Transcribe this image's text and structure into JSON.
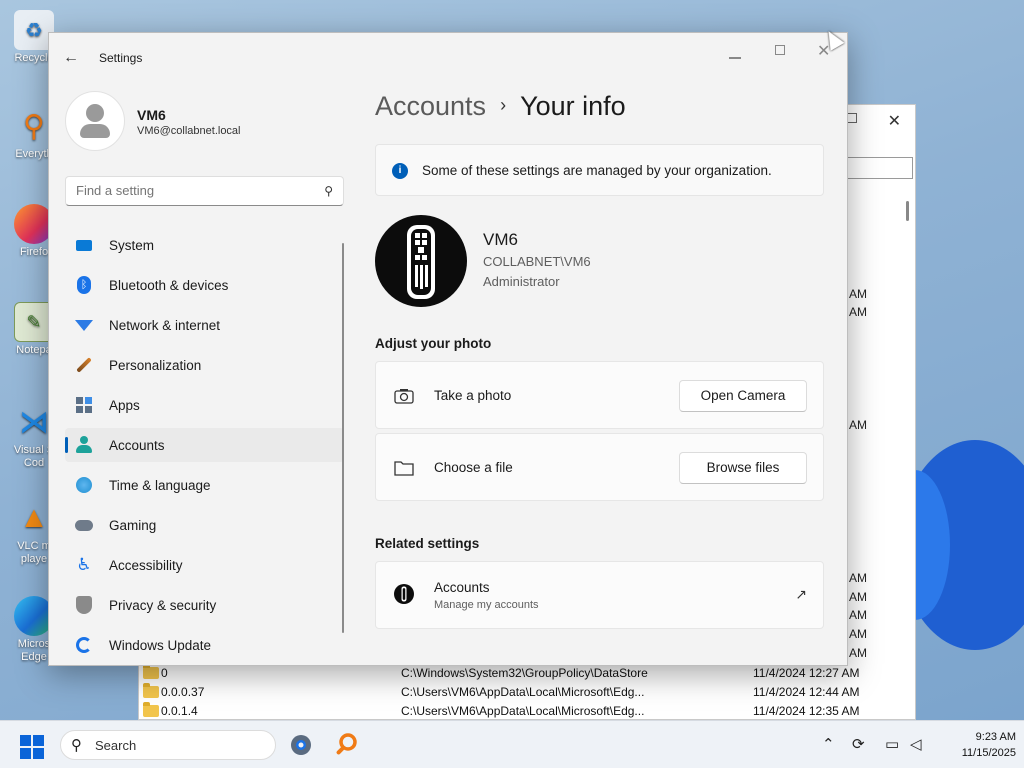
{
  "desktop": {
    "icons": [
      {
        "label": "Recycle",
        "icon": "recycle-bin-icon"
      },
      {
        "label": "Everyth",
        "icon": "everything-search-icon"
      },
      {
        "label": "Firefo",
        "icon": "firefox-icon"
      },
      {
        "label": "Notepa",
        "icon": "notepad-icon"
      },
      {
        "label": "Visual S Cod",
        "icon": "vscode-icon"
      },
      {
        "label": "VLC m playe",
        "icon": "vlc-icon"
      },
      {
        "label": "Micros Edge",
        "icon": "edge-icon"
      }
    ]
  },
  "explorer": {
    "time_fragments": [
      "AM",
      "AM",
      "AM",
      "AM",
      "AM",
      "AM",
      "AM",
      "AM",
      "AM",
      "AM",
      "AM"
    ],
    "rows": [
      {
        "name": "0",
        "path": "C:\\Windows\\System32\\GroupPolicy\\DataStore",
        "modified": "11/4/2024 12:27 AM"
      },
      {
        "name": "0.0.0.37",
        "path": "C:\\Users\\VM6\\AppData\\Local\\Microsoft\\Edg...",
        "modified": "11/4/2024 12:44 AM"
      },
      {
        "name": "0.0.1.4",
        "path": "C:\\Users\\VM6\\AppData\\Local\\Microsoft\\Edg...",
        "modified": "11/4/2024 12:35 AM"
      }
    ]
  },
  "settings": {
    "window_title": "Settings",
    "user": {
      "name": "VM6",
      "email": "VM6@collabnet.local"
    },
    "search_placeholder": "Find a setting",
    "nav": [
      {
        "label": "System",
        "icon": "monitor-icon",
        "color": "#0a7ad6"
      },
      {
        "label": "Bluetooth & devices",
        "icon": "bluetooth-icon",
        "color": "#1a73e8"
      },
      {
        "label": "Network & internet",
        "icon": "wifi-icon",
        "color": "#2c7be5"
      },
      {
        "label": "Personalization",
        "icon": "brush-icon",
        "color": "#d9822b"
      },
      {
        "label": "Apps",
        "icon": "apps-icon",
        "color": "#5b6f86"
      },
      {
        "label": "Accounts",
        "icon": "person-icon",
        "color": "#1da29a",
        "active": true
      },
      {
        "label": "Time & language",
        "icon": "globe-clock-icon",
        "color": "#1f8fd1"
      },
      {
        "label": "Gaming",
        "icon": "gamepad-icon",
        "color": "#6f7b8a"
      },
      {
        "label": "Accessibility",
        "icon": "accessibility-icon",
        "color": "#1a73e8"
      },
      {
        "label": "Privacy & security",
        "icon": "shield-icon",
        "color": "#8a8a8a"
      },
      {
        "label": "Windows Update",
        "icon": "update-icon",
        "color": "#1a73e8"
      }
    ],
    "breadcrumb": {
      "parent": "Accounts",
      "separator": "›",
      "current": "Your info"
    },
    "banner_text": "Some of these settings are managed by your organization.",
    "account": {
      "name": "VM6",
      "domain": "COLLABNET\\VM6",
      "role": "Administrator"
    },
    "adjust_photo": {
      "heading": "Adjust your photo",
      "take_photo_label": "Take a photo",
      "open_camera_button": "Open Camera",
      "choose_file_label": "Choose a file",
      "browse_files_button": "Browse files"
    },
    "related": {
      "heading": "Related settings",
      "title": "Accounts",
      "subtitle": "Manage my accounts"
    }
  },
  "taskbar": {
    "search_label": "Search",
    "time": "9:23 AM",
    "date": "11/15/2025"
  },
  "colors": {
    "accent": "#005fb8",
    "start_blue": "#0a64d8",
    "folder": "#f2c54c"
  }
}
